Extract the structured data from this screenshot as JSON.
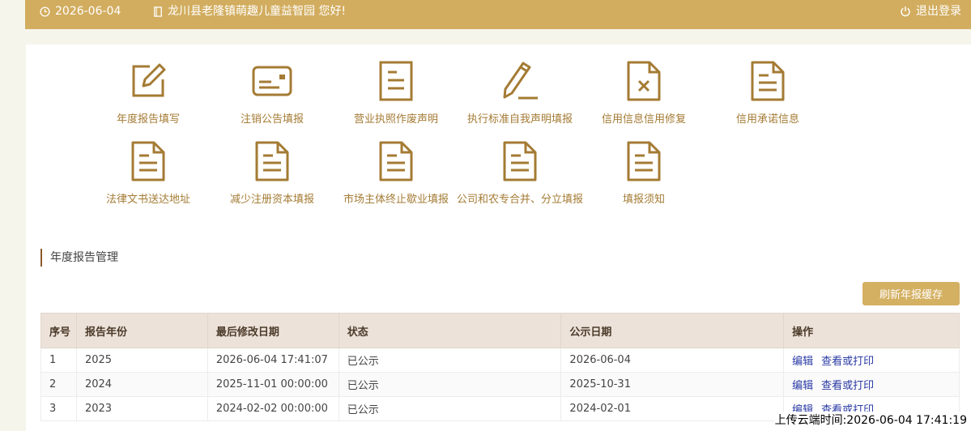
{
  "header": {
    "date": "2026-06-04",
    "welcome": "龙川县老隆镇萌趣儿童益智园 您好!",
    "logout_label": "退出登录"
  },
  "shortcuts": [
    {
      "label": "年度报告填写",
      "icon": "edit-icon"
    },
    {
      "label": "注销公告填报",
      "icon": "card-icon"
    },
    {
      "label": "营业执照作废声明",
      "icon": "document-icon"
    },
    {
      "label": "执行标准自我声明填报",
      "icon": "pen-icon"
    },
    {
      "label": "信用信息信用修复",
      "icon": "document-x-icon"
    },
    {
      "label": "信用承诺信息",
      "icon": "document-icon"
    },
    {
      "label": "法律文书送达地址",
      "icon": "document-icon"
    },
    {
      "label": "减少注册资本填报",
      "icon": "document-icon"
    },
    {
      "label": "市场主体终止歇业填报",
      "icon": "document-icon"
    },
    {
      "label": "公司和农专合并、分立填报",
      "icon": "document-icon"
    },
    {
      "label": "填报须知",
      "icon": "document-icon"
    }
  ],
  "section": {
    "title": "年度报告管理",
    "refresh_label": "刷新年报缓存"
  },
  "table": {
    "headers": [
      "序号",
      "报告年份",
      "最后修改日期",
      "状态",
      "公示日期",
      "操作"
    ],
    "rows": [
      {
        "no": "1",
        "year": "2025",
        "modified": "2026-06-04 17:41:07",
        "status": "已公示",
        "publish": "2026-06-04"
      },
      {
        "no": "2",
        "year": "2024",
        "modified": "2025-11-01 00:00:00",
        "status": "已公示",
        "publish": "2025-10-31"
      },
      {
        "no": "3",
        "year": "2023",
        "modified": "2024-02-02 00:00:00",
        "status": "已公示",
        "publish": "2024-02-01"
      }
    ],
    "actions": {
      "edit": "编辑",
      "view": "查看或打印"
    }
  },
  "upload_time": "上传云端时间:2026-06-04 17:41:19",
  "colors": {
    "brand": "#d2ad5f",
    "icon": "#a47b34",
    "link": "#2a3aa5"
  }
}
